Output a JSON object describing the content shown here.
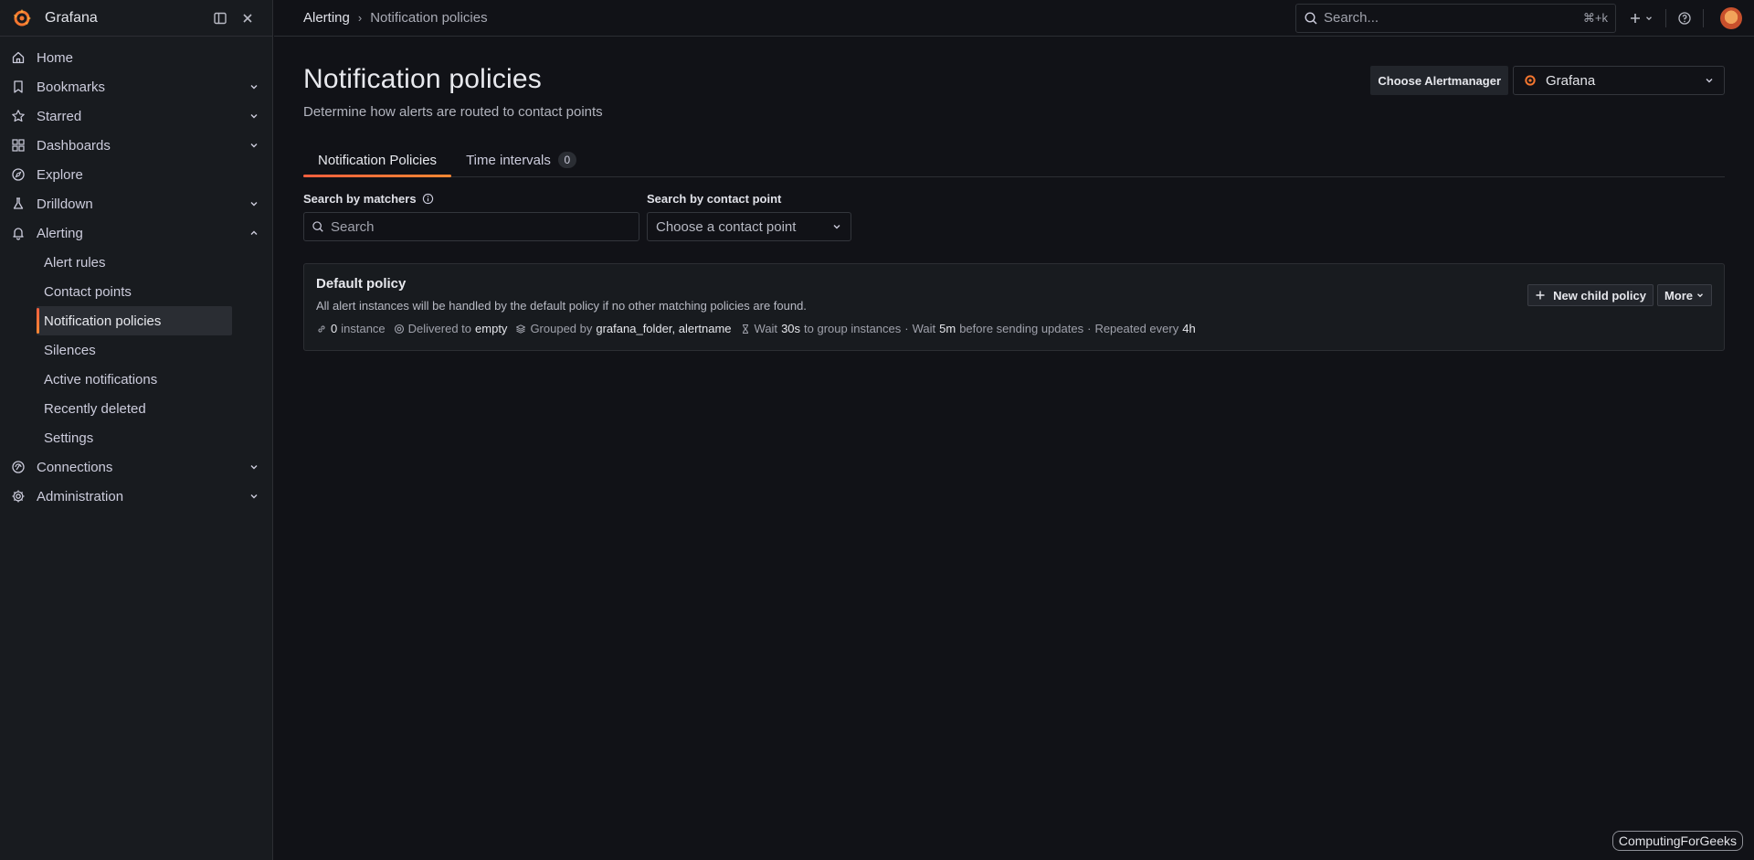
{
  "app": {
    "name": "Grafana"
  },
  "colors": {
    "accent": "#f55f3e",
    "accent2": "#ff8833",
    "background": "#111217",
    "panel": "#181b1f"
  },
  "sidebar": {
    "items": [
      {
        "label": "Home",
        "icon": "home-icon"
      },
      {
        "label": "Bookmarks",
        "icon": "bookmark-icon",
        "expandable": true
      },
      {
        "label": "Starred",
        "icon": "star-icon",
        "expandable": true
      },
      {
        "label": "Dashboards",
        "icon": "apps-icon",
        "expandable": true
      },
      {
        "label": "Explore",
        "icon": "compass-icon"
      },
      {
        "label": "Drilldown",
        "icon": "drilldown-icon",
        "expandable": true
      },
      {
        "label": "Alerting",
        "icon": "bell-icon",
        "expanded": true
      },
      {
        "label": "Connections",
        "icon": "connections-icon",
        "expandable": true
      },
      {
        "label": "Administration",
        "icon": "cog-icon",
        "expandable": true
      }
    ],
    "alerting_children": [
      "Alert rules",
      "Contact points",
      "Notification policies",
      "Silences",
      "Active notifications",
      "Recently deleted",
      "Settings"
    ]
  },
  "topbar": {
    "breadcrumb": [
      "Alerting",
      "Notification policies"
    ],
    "search_placeholder": "Search...",
    "search_shortcut": "⌘+k"
  },
  "page": {
    "title": "Notification policies",
    "subtitle": "Determine how alerts are routed to contact points",
    "alertmanager_label": "Choose Alertmanager",
    "alertmanager_value": "Grafana",
    "tabs": [
      {
        "label": "Notification Policies",
        "active": true
      },
      {
        "label": "Time intervals",
        "count": "0"
      }
    ],
    "filters": {
      "matchers_label": "Search by matchers",
      "matchers_placeholder": "Search",
      "contact_label": "Search by contact point",
      "contact_placeholder": "Choose a contact point"
    },
    "default_policy": {
      "title": "Default policy",
      "description": "All alert instances will be handled by the default policy if no other matching policies are found.",
      "instances_count": "0",
      "instances_label": "instance",
      "delivered_label": "Delivered to",
      "delivered_value": "empty",
      "grouped_label": "Grouped by",
      "grouped_value": "grafana_folder, alertname",
      "wait_label": "Wait",
      "group_wait": "30s",
      "group_wait_after": "to group instances",
      "sep1": "·",
      "wait2_label": "Wait",
      "group_interval": "5m",
      "group_interval_after": "before sending updates",
      "sep2": "·",
      "repeat_label": "Repeated every",
      "repeat_interval": "4h",
      "new_child_label": "New child policy",
      "more_label": "More"
    }
  },
  "watermark": "ComputingForGeeks"
}
